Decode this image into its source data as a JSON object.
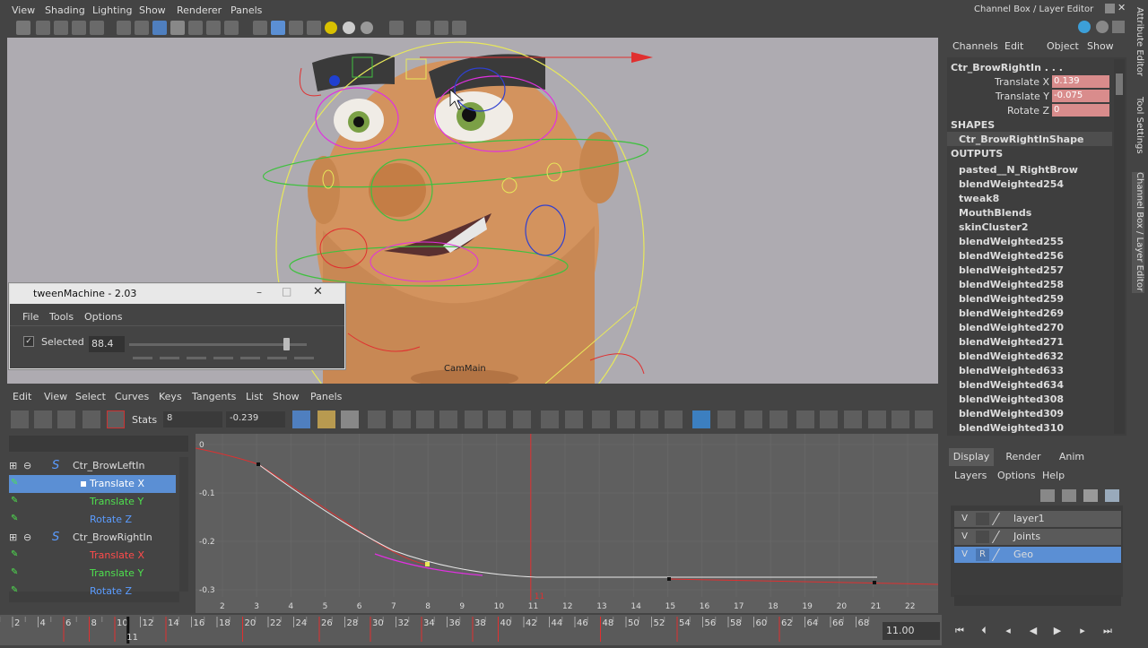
{
  "menubar": {
    "items": [
      "View",
      "Shading",
      "Lighting",
      "Show",
      "Renderer",
      "Panels"
    ]
  },
  "channel_box_title": "Channel Box / Layer Editor",
  "channel_box": {
    "menu": [
      "Channels",
      "Edit",
      "Object",
      "Show"
    ],
    "node": "Ctr_BrowRightIn . . .",
    "attrs": [
      {
        "label": "Translate X",
        "value": "0.139"
      },
      {
        "label": "Translate Y",
        "value": "-0.075"
      },
      {
        "label": "Rotate Z",
        "value": "0"
      }
    ],
    "shapes_header": "SHAPES",
    "shape": "Ctr_BrowRightInShape",
    "outputs_header": "OUTPUTS",
    "outputs": [
      "pasted__N_RightBrow",
      "blendWeighted254",
      "tweak8",
      "MouthBlends",
      "skinCluster2",
      "blendWeighted255",
      "blendWeighted256",
      "blendWeighted257",
      "blendWeighted258",
      "blendWeighted259",
      "blendWeighted269",
      "blendWeighted270",
      "blendWeighted271",
      "blendWeighted632",
      "blendWeighted633",
      "blendWeighted634",
      "blendWeighted308",
      "blendWeighted309",
      "blendWeighted310"
    ]
  },
  "side_tabs": [
    "Attribute Editor",
    "Tool Settings",
    "Channel Box / Layer Editor"
  ],
  "viewport": {
    "camera_label": "CamMain"
  },
  "tween": {
    "title": "tweenMachine - 2.03",
    "menu": [
      "File",
      "Tools",
      "Options"
    ],
    "selected_label": "Selected",
    "value": "88.4",
    "slider_fraction": 0.884
  },
  "graph_editor": {
    "menu": [
      "Edit",
      "View",
      "Select",
      "Curves",
      "Keys",
      "Tangents",
      "List",
      "Show",
      "Panels"
    ],
    "stats_label": "Stats",
    "stats_frame": "8",
    "stats_value": "-0.239",
    "outliner": [
      {
        "label": "Ctr_BrowLeftIn",
        "type": "node"
      },
      {
        "label": "Translate X",
        "type": "attr",
        "color": "#ffffff",
        "selected": true
      },
      {
        "label": "Translate Y",
        "type": "attr",
        "color": "#4ee04e"
      },
      {
        "label": "Rotate Z",
        "type": "attr",
        "color": "#5b9cff"
      },
      {
        "label": "Ctr_BrowRightIn",
        "type": "node"
      },
      {
        "label": "Translate X",
        "type": "attr",
        "color": "#ff4b4b"
      },
      {
        "label": "Translate Y",
        "type": "attr",
        "color": "#4ee04e"
      },
      {
        "label": "Rotate Z",
        "type": "attr",
        "color": "#5b9cff"
      }
    ],
    "y_ticks": [
      "0",
      "-0.1",
      "-0.2",
      "-0.3"
    ],
    "x_ticks": [
      "2",
      "3",
      "4",
      "5",
      "6",
      "7",
      "8",
      "9",
      "10",
      "11",
      "12",
      "13",
      "14",
      "15",
      "16",
      "17",
      "18",
      "19",
      "20",
      "21",
      "22"
    ],
    "current_frame_marker": "11"
  },
  "timeline": {
    "ticks": [
      "2",
      "4",
      "6",
      "8",
      "10",
      "12",
      "14",
      "16",
      "18",
      "20",
      "22",
      "24",
      "26",
      "28",
      "30",
      "32",
      "34",
      "36",
      "38",
      "40",
      "42",
      "44",
      "46",
      "48",
      "50",
      "52",
      "54",
      "56",
      "58",
      "60",
      "62",
      "64",
      "66",
      "68"
    ],
    "current_frame": "11",
    "current_time_field": "11.00"
  },
  "layer_editor": {
    "tabs": [
      "Display",
      "Render",
      "Anim"
    ],
    "menu": [
      "Layers",
      "Options",
      "Help"
    ],
    "layers": [
      {
        "name": "layer1",
        "v": "V",
        "r": ""
      },
      {
        "name": "Joints",
        "v": "V",
        "r": ""
      },
      {
        "name": "Geo",
        "v": "V",
        "r": "R",
        "selected": true
      }
    ]
  },
  "colors": {
    "accent": "#5b8fd4",
    "key_red": "#e03030",
    "attr_highlight": "#d98c8c"
  }
}
